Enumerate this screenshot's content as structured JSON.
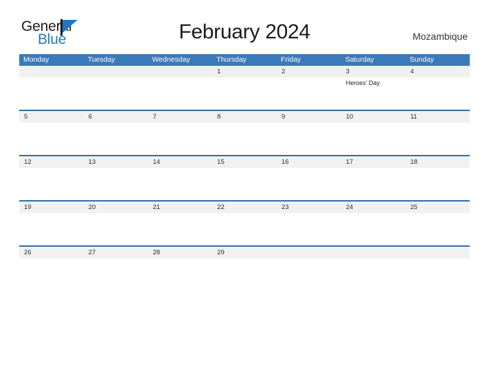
{
  "brand": {
    "name_part1": "General",
    "name_part2": "Blue",
    "flag_icon": "blue-triangle-flag-icon",
    "accent_color": "#1f78c1"
  },
  "header": {
    "title": "February 2024",
    "country": "Mozambique"
  },
  "theme": {
    "weekday_header_bg": "#3a7ab8",
    "week_divider": "#2e6da4",
    "date_band_bg": "#f1f1f1",
    "text_color": "#2b2b2b"
  },
  "calendar": {
    "month": "February",
    "year": "2024",
    "weekday_labels": [
      "Monday",
      "Tuesday",
      "Wednesday",
      "Thursday",
      "Friday",
      "Saturday",
      "Sunday"
    ],
    "weeks": [
      {
        "days": [
          {
            "num": "",
            "events": []
          },
          {
            "num": "",
            "events": []
          },
          {
            "num": "",
            "events": []
          },
          {
            "num": "1",
            "events": []
          },
          {
            "num": "2",
            "events": []
          },
          {
            "num": "3",
            "events": [
              "Heroes' Day"
            ]
          },
          {
            "num": "4",
            "events": []
          }
        ]
      },
      {
        "days": [
          {
            "num": "5",
            "events": []
          },
          {
            "num": "6",
            "events": []
          },
          {
            "num": "7",
            "events": []
          },
          {
            "num": "8",
            "events": []
          },
          {
            "num": "9",
            "events": []
          },
          {
            "num": "10",
            "events": []
          },
          {
            "num": "11",
            "events": []
          }
        ]
      },
      {
        "days": [
          {
            "num": "12",
            "events": []
          },
          {
            "num": "13",
            "events": []
          },
          {
            "num": "14",
            "events": []
          },
          {
            "num": "15",
            "events": []
          },
          {
            "num": "16",
            "events": []
          },
          {
            "num": "17",
            "events": []
          },
          {
            "num": "18",
            "events": []
          }
        ]
      },
      {
        "days": [
          {
            "num": "19",
            "events": []
          },
          {
            "num": "20",
            "events": []
          },
          {
            "num": "21",
            "events": []
          },
          {
            "num": "22",
            "events": []
          },
          {
            "num": "23",
            "events": []
          },
          {
            "num": "24",
            "events": []
          },
          {
            "num": "25",
            "events": []
          }
        ]
      },
      {
        "days": [
          {
            "num": "26",
            "events": []
          },
          {
            "num": "27",
            "events": []
          },
          {
            "num": "28",
            "events": []
          },
          {
            "num": "29",
            "events": []
          },
          {
            "num": "",
            "events": []
          },
          {
            "num": "",
            "events": []
          },
          {
            "num": "",
            "events": []
          }
        ]
      }
    ]
  }
}
